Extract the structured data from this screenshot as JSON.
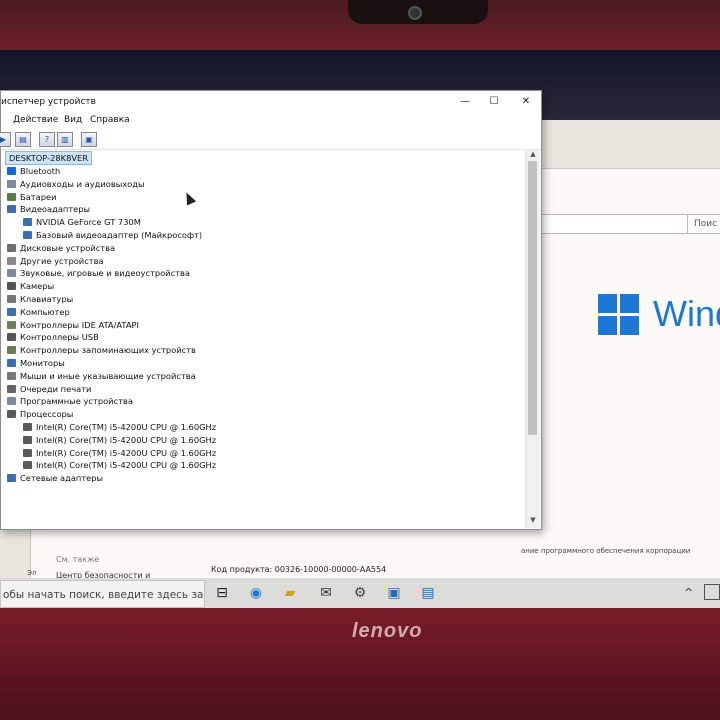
{
  "device_manager": {
    "title": "испетчер устройств",
    "menu": [
      "Действие",
      "Вид",
      "Справка"
    ],
    "root": "DESKTOP-28K8VER",
    "tree": [
      {
        "label": "Bluetooth",
        "level": 0,
        "icon": "bluetooth-icon"
      },
      {
        "label": "Аудиовходы и аудиовыходы",
        "level": 0,
        "icon": "speaker-icon"
      },
      {
        "label": "Батареи",
        "level": 0,
        "icon": "battery-icon"
      },
      {
        "label": "Видеоадаптеры",
        "level": 0,
        "icon": "display-adapter-icon"
      },
      {
        "label": "NVIDIA GeForce GT 730M",
        "level": 1,
        "icon": "display-adapter-icon"
      },
      {
        "label": "Базовый видеоадаптер (Майкрософт)",
        "level": 1,
        "icon": "display-adapter-icon"
      },
      {
        "label": "Дисковые устройства",
        "level": 0,
        "icon": "disk-icon"
      },
      {
        "label": "Другие устройства",
        "level": 0,
        "icon": "unknown-device-icon"
      },
      {
        "label": "Звуковые, игровые и видеоустройства",
        "level": 0,
        "icon": "sound-icon"
      },
      {
        "label": "Камеры",
        "level": 0,
        "icon": "camera-icon"
      },
      {
        "label": "Клавиатуры",
        "level": 0,
        "icon": "keyboard-icon"
      },
      {
        "label": "Компьютер",
        "level": 0,
        "icon": "computer-icon"
      },
      {
        "label": "Контроллеры IDE ATA/ATAPI",
        "level": 0,
        "icon": "controller-icon"
      },
      {
        "label": "Контроллеры USB",
        "level": 0,
        "icon": "usb-icon"
      },
      {
        "label": "Контроллеры запоминающих устройств",
        "level": 0,
        "icon": "storage-icon"
      },
      {
        "label": "Мониторы",
        "level": 0,
        "icon": "monitor-icon"
      },
      {
        "label": "Мыши и иные указывающие устройства",
        "level": 0,
        "icon": "mouse-icon"
      },
      {
        "label": "Очереди печати",
        "level": 0,
        "icon": "printer-icon"
      },
      {
        "label": "Программные устройства",
        "level": 0,
        "icon": "software-device-icon"
      },
      {
        "label": "Процессоры",
        "level": 0,
        "icon": "processor-icon",
        "expanded": true
      },
      {
        "label": "Intel(R) Core(TM) i5-4200U CPU @ 1.60GHz",
        "level": 1,
        "icon": "processor-icon"
      },
      {
        "label": "Intel(R) Core(TM) i5-4200U CPU @ 1.60GHz",
        "level": 1,
        "icon": "processor-icon"
      },
      {
        "label": "Intel(R) Core(TM) i5-4200U CPU @ 1.60GHz",
        "level": 1,
        "icon": "processor-icon"
      },
      {
        "label": "Intel(R) Core(TM) i5-4200U CPU @ 1.60GHz",
        "level": 1,
        "icon": "processor-icon"
      },
      {
        "label": "Сетевые адаптеры",
        "level": 0,
        "icon": "network-icon"
      }
    ]
  },
  "system_window": {
    "search_placeholder": "Поис",
    "windows_text": "Wind",
    "license_line": "ание программного обеспечения корпорации",
    "product_id": "Код продукта: 00326-10000-00000-AA554",
    "see_also": "См. также",
    "security_center": "Центр безопасности и обслуживания",
    "el_label": "Эл"
  },
  "taskbar": {
    "search_text": "обы начать поиск, введите здесь запрос"
  },
  "brand": "lenovo"
}
